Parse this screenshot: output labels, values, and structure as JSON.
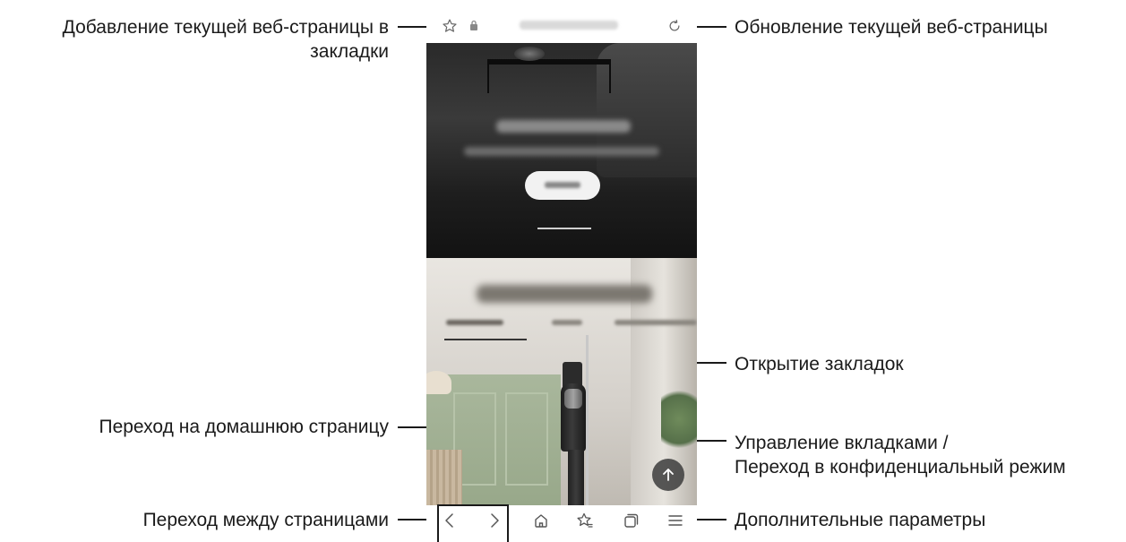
{
  "callouts": {
    "bookmark_add_line1": "Добавление текущей веб-страницы в",
    "bookmark_add_line2": "закладки",
    "refresh": "Обновление текущей веб-страницы",
    "open_bookmarks": "Открытие закладок",
    "home": "Переход на домашнюю страницу",
    "tabs_line1": "Управление вкладками /",
    "tabs_line2": "Переход в конфиденциальный режим",
    "navigate": "Переход между страницами",
    "more": "Дополнительные параметры"
  },
  "browser": {
    "toolbar_icons": [
      "star-outline-icon",
      "lock-icon",
      "reload-icon"
    ],
    "nav_icons": [
      "chevron-left-icon",
      "chevron-right-icon",
      "home-icon",
      "bookmarks-icon",
      "tabs-icon",
      "menu-icon"
    ],
    "scroll_to_top_icon": "arrow-up-icon"
  },
  "colors": {
    "text": "#1a1a1a",
    "hero_dark": "#1e1e1e",
    "wall_green": "#a9b79c"
  }
}
